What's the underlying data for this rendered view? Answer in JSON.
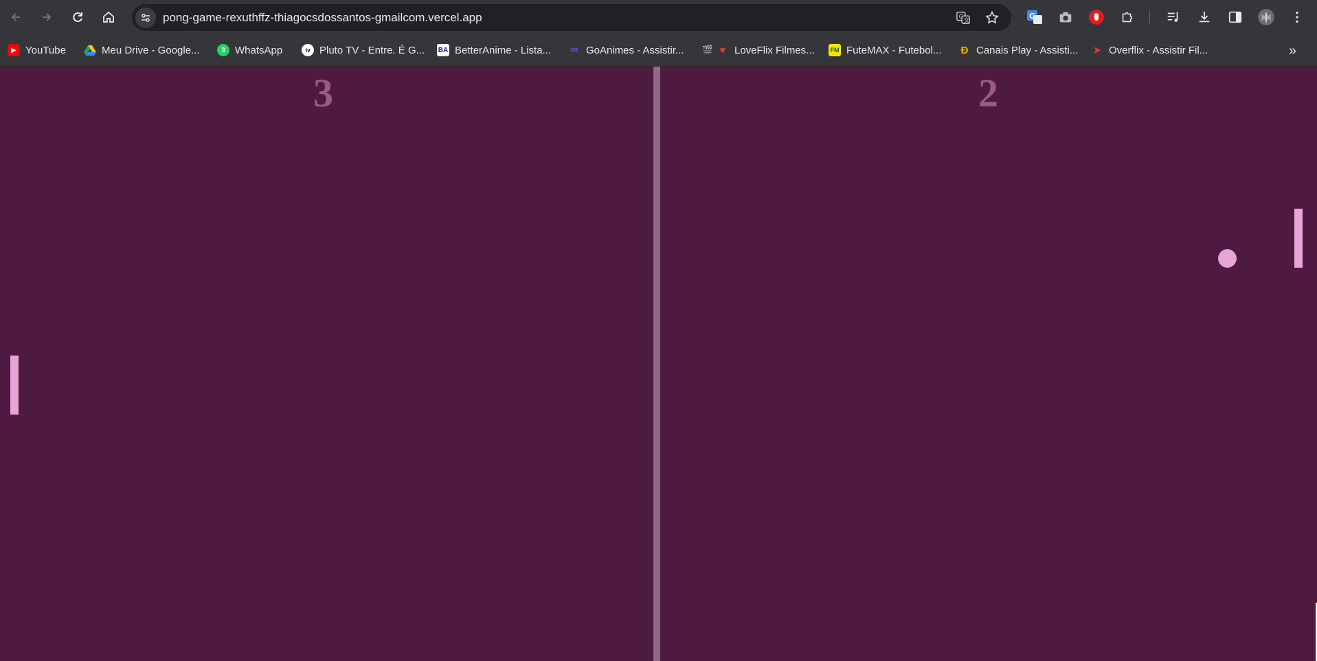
{
  "browser": {
    "url": "pong-game-rexuthffz-thiagocsdossantos-gmailcom.vercel.app"
  },
  "bookmarks": [
    {
      "label": "YouTube",
      "icon": "youtube-icon",
      "color": "#ff0000"
    },
    {
      "label": "Meu Drive - Google...",
      "icon": "google-drive-icon",
      "color": "#1fa463"
    },
    {
      "label": "WhatsApp",
      "icon": "whatsapp-icon",
      "color": "#25d366"
    },
    {
      "label": "Pluto TV - Entre. É G...",
      "icon": "pluto-tv-icon",
      "color": "#111111"
    },
    {
      "label": "BetterAnime - Lista...",
      "icon": "betteranime-icon",
      "color": "#ffffff"
    },
    {
      "label": "GoAnimes - Assistir...",
      "icon": "goanimes-icon",
      "color": "#7b3fe4"
    },
    {
      "label": "LoveFlix Filmes...",
      "icon": "loveflix-icon",
      "color": "#e53935"
    },
    {
      "label": "FuteMAX - Futebol...",
      "icon": "futemax-icon",
      "color": "#f5e600"
    },
    {
      "label": "Canais Play - Assisti...",
      "icon": "canais-play-icon",
      "color": "#f4b400"
    },
    {
      "label": "Overflix - Assistir Fil...",
      "icon": "overflix-icon",
      "color": "#e53935"
    }
  ],
  "game": {
    "score_left": "3",
    "score_right": "2",
    "colors": {
      "background": "#4e1a3f",
      "net": "#8f6a83",
      "score": "#9b5a86",
      "paddle": "#e7a4d5",
      "ball": "#e7a4d5"
    }
  }
}
